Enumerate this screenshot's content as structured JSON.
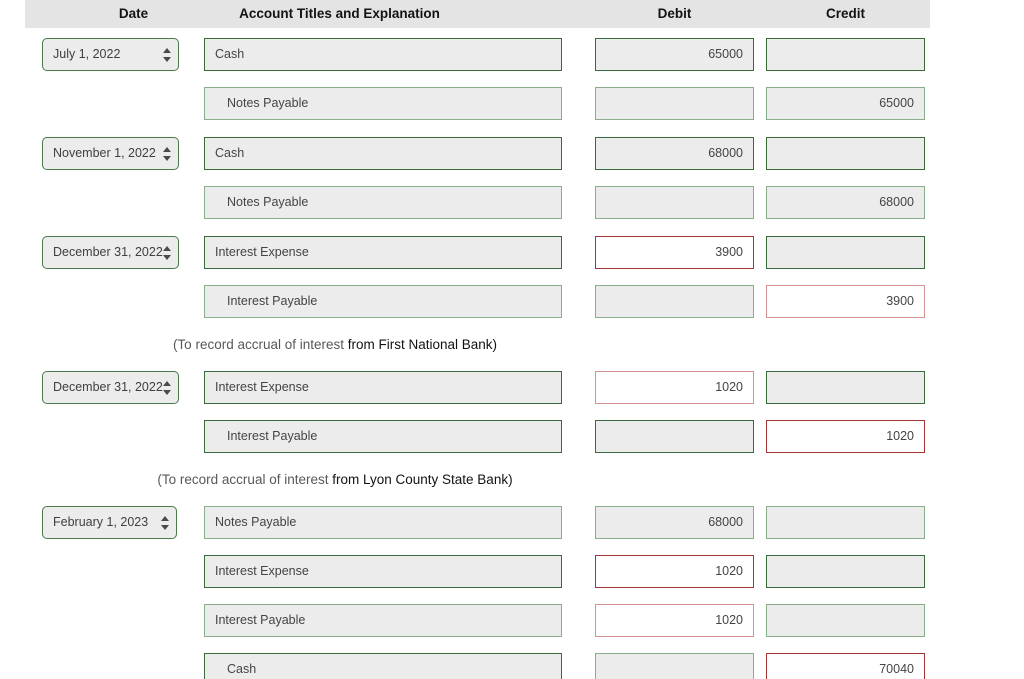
{
  "table": {
    "headers": {
      "date": "Date",
      "account": "Account Titles and Explanation",
      "debit": "Debit",
      "credit": "Credit"
    },
    "header_bg": "#e4e4e4"
  },
  "colors": {
    "border_green_dark": "#3a6b3a",
    "border_green_light": "#8aad8a",
    "border_red_dark": "#a53535",
    "border_red_light": "#d29292",
    "field_fill": "#ececec",
    "field_fill_white": "#ffffff",
    "text": "#444444"
  },
  "icons": {
    "spinner": "spinner-arrows-icon"
  },
  "entries": [
    {
      "date": "July 1, 2022",
      "lines": [
        {
          "account": "Cash",
          "indent": false,
          "debit": "65000",
          "credit": "",
          "account_border": "green-dark",
          "debit_border": "green-dark",
          "credit_border": "green-dark",
          "debit_white": false,
          "credit_white": false
        },
        {
          "account": "Notes Payable",
          "indent": true,
          "debit": "",
          "credit": "65000",
          "account_border": "green-light",
          "debit_border": "green-light",
          "credit_border": "green-light",
          "debit_white": false,
          "credit_white": false
        }
      ],
      "explanation": null
    },
    {
      "date": "November 1, 2022",
      "lines": [
        {
          "account": "Cash",
          "indent": false,
          "debit": "68000",
          "credit": "",
          "account_border": "green-dark",
          "debit_border": "green-dark",
          "credit_border": "green-dark",
          "debit_white": false,
          "credit_white": false
        },
        {
          "account": "Notes Payable",
          "indent": true,
          "debit": "",
          "credit": "68000",
          "account_border": "green-light",
          "debit_border": "green-light",
          "credit_border": "green-light",
          "debit_white": false,
          "credit_white": false
        }
      ],
      "explanation": null
    },
    {
      "date": "December 31, 2022",
      "lines": [
        {
          "account": "Interest Expense",
          "indent": false,
          "debit": "3900",
          "credit": "",
          "account_border": "green-dark",
          "debit_border": "red-dark",
          "credit_border": "green-dark",
          "debit_white": true,
          "credit_white": false
        },
        {
          "account": "Interest Payable",
          "indent": true,
          "debit": "",
          "credit": "3900",
          "account_border": "green-light",
          "debit_border": "green-light",
          "credit_border": "red-light",
          "debit_white": false,
          "credit_white": true
        }
      ],
      "explanation": {
        "dim": "(To record accrual of interest ",
        "bold": "from First National Bank)"
      }
    },
    {
      "date": "December 31, 2022",
      "lines": [
        {
          "account": "Interest Expense",
          "indent": false,
          "debit": "1020",
          "credit": "",
          "account_border": "green-dark",
          "debit_border": "red-light",
          "credit_border": "green-dark",
          "debit_white": true,
          "credit_white": false
        },
        {
          "account": "Interest Payable",
          "indent": true,
          "debit": "",
          "credit": "1020",
          "account_border": "green-dark",
          "debit_border": "green-dark",
          "credit_border": "red-dark",
          "debit_white": false,
          "credit_white": true
        }
      ],
      "explanation": {
        "dim": "(To record accrual of interest ",
        "bold": "from Lyon County State Bank)"
      }
    },
    {
      "date": "February 1, 2023",
      "lines": [
        {
          "account": "Notes Payable",
          "indent": false,
          "debit": "68000",
          "credit": "",
          "account_border": "green-light",
          "debit_border": "green-light",
          "credit_border": "green-light",
          "debit_white": false,
          "credit_white": false
        },
        {
          "account": "Interest Expense",
          "indent": false,
          "debit": "1020",
          "credit": "",
          "account_border": "green-dark",
          "debit_border": "red-dark",
          "credit_border": "green-dark",
          "debit_white": true,
          "credit_white": false
        },
        {
          "account": "Interest Payable",
          "indent": false,
          "debit": "1020",
          "credit": "",
          "account_border": "green-light",
          "debit_border": "red-light",
          "credit_border": "green-light",
          "debit_white": true,
          "credit_white": false
        },
        {
          "account": "Cash",
          "indent": true,
          "debit": "",
          "credit": "70040",
          "account_border": "green-dark",
          "debit_border": "green-light",
          "credit_border": "red-dark",
          "debit_white": false,
          "credit_white": true
        }
      ],
      "explanation": null
    }
  ]
}
